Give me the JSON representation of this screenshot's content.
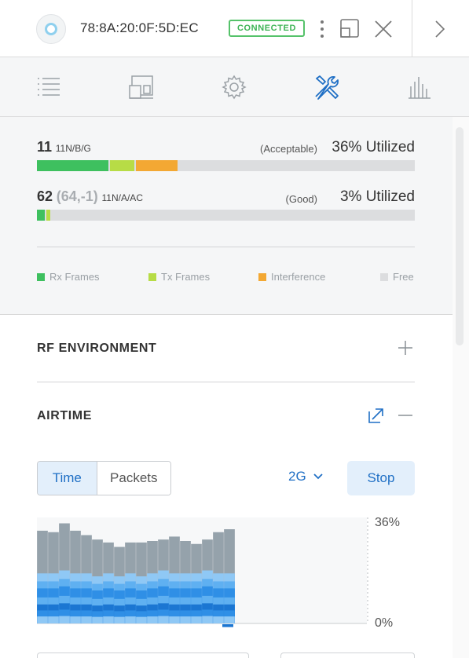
{
  "header": {
    "device_mac": "78:8A:20:0F:5D:EC",
    "status_badge": "CONNECTED",
    "icons": [
      "more-vert-icon",
      "popout-icon",
      "close-icon",
      "chevron-right-icon"
    ]
  },
  "toolbar": {
    "tabs": [
      {
        "name": "list-icon",
        "active": false
      },
      {
        "name": "devices-icon",
        "active": false
      },
      {
        "name": "gear-icon",
        "active": false
      },
      {
        "name": "tools-icon",
        "active": true
      },
      {
        "name": "stats-icon",
        "active": false
      }
    ]
  },
  "utilization": {
    "radios": [
      {
        "channel": "11",
        "channel_detail": "",
        "protocol": "11N/B/G",
        "quality": "(Acceptable)",
        "utilized": "36% Utilized",
        "rx_pct": 19,
        "tx_pct": 6.5,
        "interference_pct": 11
      },
      {
        "channel": "62",
        "channel_detail": "(64,-1)",
        "protocol": "11N/A/AC",
        "quality": "(Good)",
        "utilized": "3% Utilized",
        "rx_pct": 2.0,
        "tx_pct": 1.0,
        "interference_pct": 0
      }
    ],
    "legend": [
      {
        "label": "Rx Frames",
        "color": "#3ec05f"
      },
      {
        "label": "Tx Frames",
        "color": "#b7dc46"
      },
      {
        "label": "Interference",
        "color": "#f3a833"
      },
      {
        "label": "Free",
        "color": "#dcdddf"
      }
    ]
  },
  "sections": {
    "rf_environment": "RF ENVIRONMENT",
    "airtime": "AIRTIME"
  },
  "airtime": {
    "view_toggle": [
      "Time",
      "Packets"
    ],
    "active_view": "Time",
    "band": "2G",
    "stop_label": "Stop"
  },
  "chart_data": {
    "type": "area",
    "ylim": [
      0,
      36
    ],
    "y_ticks": [
      "36%",
      "0%"
    ],
    "colors": {
      "grey": "#95a2ab",
      "blue_light": "#8fc8f5",
      "blue_mid": "#5fb0f1",
      "blue": "#2f8fe6",
      "blue_dark": "#1b76d2"
    },
    "bars": [
      {
        "total": 31.5,
        "blue": 17
      },
      {
        "total": 31,
        "blue": 17
      },
      {
        "total": 34,
        "blue": 18
      },
      {
        "total": 31.5,
        "blue": 17
      },
      {
        "total": 30,
        "blue": 17
      },
      {
        "total": 28.5,
        "blue": 16
      },
      {
        "total": 27.5,
        "blue": 17
      },
      {
        "total": 26,
        "blue": 16
      },
      {
        "total": 27.5,
        "blue": 17
      },
      {
        "total": 27.5,
        "blue": 16
      },
      {
        "total": 28,
        "blue": 17
      },
      {
        "total": 28.5,
        "blue": 18
      },
      {
        "total": 29.5,
        "blue": 17
      },
      {
        "total": 28,
        "blue": 17
      },
      {
        "total": 27,
        "blue": 17
      },
      {
        "total": 28.5,
        "blue": 18
      },
      {
        "total": 31,
        "blue": 17
      },
      {
        "total": 32,
        "blue": 17
      }
    ],
    "current_marker_value": 1.2
  }
}
